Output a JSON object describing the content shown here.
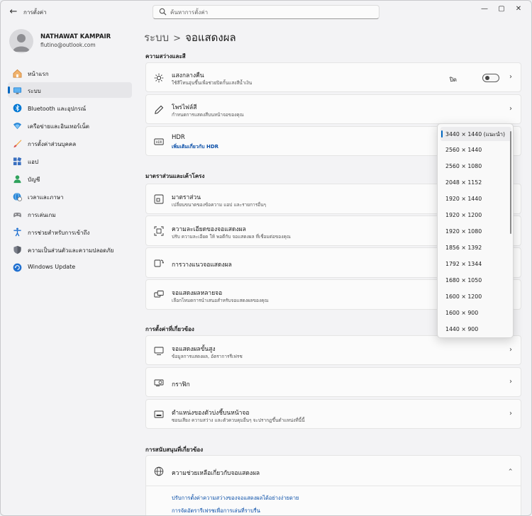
{
  "window": {
    "app_title": "การตั้งค่า",
    "search_placeholder": "ค้นหาการตั้งค่า",
    "minimize": "—",
    "maximize": "▢",
    "close": "✕",
    "back": "←"
  },
  "profile": {
    "name": "NATHAWAT KAMPAIR",
    "email": "flutino@outlook.com"
  },
  "sidebar": {
    "items": [
      {
        "label": "หน้าแรก",
        "icon": "home-icon"
      },
      {
        "label": "ระบบ",
        "icon": "system-icon",
        "selected": true
      },
      {
        "label": "Bluetooth และอุปกรณ์",
        "icon": "bluetooth-icon"
      },
      {
        "label": "เครือข่ายและอินเทอร์เน็ต",
        "icon": "wifi-icon"
      },
      {
        "label": "การตั้งค่าส่วนบุคคล",
        "icon": "brush-icon"
      },
      {
        "label": "แอป",
        "icon": "apps-icon"
      },
      {
        "label": "บัญชี",
        "icon": "account-icon"
      },
      {
        "label": "เวลาและภาษา",
        "icon": "globe-clock-icon"
      },
      {
        "label": "การเล่นเกม",
        "icon": "gamepad-icon"
      },
      {
        "label": "การช่วยสำหรับการเข้าถึง",
        "icon": "accessibility-icon"
      },
      {
        "label": "ความเป็นส่วนตัวและความปลอดภัย",
        "icon": "shield-icon"
      },
      {
        "label": "Windows Update",
        "icon": "update-icon"
      }
    ]
  },
  "breadcrumb": {
    "parent": "ระบบ",
    "separator": ">",
    "current": "จอแสดงผล"
  },
  "sections": {
    "brightness": "ความสว่างและสี",
    "scale_layout": "มาตราส่วนและเค้าโครง",
    "related": "การตั้งค่าที่เกี่ยวข้อง",
    "support": "การสนับสนุนที่เกี่ยวข้อง"
  },
  "cards": {
    "night_light": {
      "title": "แสงกลางคืน",
      "sub": "ใช้สีโทนอุ่นขึ้นเพื่อช่วยปิดกั้นแสงสีน้ำเงิน",
      "toggle_label": "ปิด",
      "toggle_on": false
    },
    "color_profile": {
      "title": "โพรไฟล์สี",
      "sub": "กำหนดการแสดงสีบนหน้าจอของคุณ"
    },
    "hdr": {
      "title": "HDR",
      "link": "เพิ่มเติมเกี่ยวกับ HDR"
    },
    "scale": {
      "title": "มาตราส่วน",
      "sub": "เปลี่ยนขนาดของข้อความ แอป และรายการอื่นๆ"
    },
    "resolution": {
      "title": "ความละเอียดของจอแสดงผล",
      "sub": "ปรับ ความละเอียด ให้ พอดีกับ จอแสดงผล ที่เชื่อมต่อของคุณ"
    },
    "orientation": {
      "title": "การวางแนวจอแสดงผล"
    },
    "multiple": {
      "title": "จอแสดงผลหลายจอ",
      "sub": "เลือกโหมดการนำเสนอสำหรับจอแสดงผลของคุณ"
    },
    "advanced": {
      "title": "จอแสดงผลขั้นสูง",
      "sub": "ข้อมูลการแสดงผล, อัตราการรีเฟรช"
    },
    "graphics": {
      "title": "กราฟิก"
    },
    "taskbar_pos": {
      "title": "ตำแหน่งของตัวบ่งชี้บนหน้าจอ",
      "sub": "ซอนเสียง ความสว่าง และตัวควบคุมอื่นๆ จะปรากฏขึ้นตำแหน่งที่นี้นี้"
    },
    "help": {
      "title": "ความช่วยเหลือเกี่ยวกับจอแสดงผล"
    }
  },
  "help_links": [
    "ปรับการตั้งค่าความสว่างของจอแสดงผลได้อย่างง่ายดาย",
    "การจัดอัตรารีเฟรชเพื่อการเล่นที่ราบรื่น"
  ],
  "resolution_dropdown": {
    "options": [
      "3440 × 1440 (แนะนำ)",
      "2560 × 1440",
      "2560 × 1080",
      "2048 × 1152",
      "1920 × 1440",
      "1920 × 1200",
      "1920 × 1080",
      "1856 × 1392",
      "1792 × 1344",
      "1680 × 1050",
      "1600 × 1200",
      "1600 × 900",
      "1440 × 900"
    ],
    "selected_index": 0
  },
  "colors": {
    "accent": "#0067c0",
    "link": "#0a4fa8",
    "card_bg": "#fbfbfb",
    "window_bg": "#f3f3f5"
  }
}
